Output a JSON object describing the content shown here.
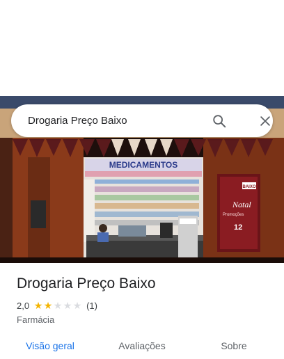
{
  "search": {
    "query": "Drogaria Preço Baixo"
  },
  "place": {
    "name": "Drogaria Preço Baixo",
    "rating": "2,0",
    "rating_fraction": 0.4,
    "review_count": "(1)",
    "category": "Farmácia"
  },
  "photo": {
    "sign_text": "MEDICAMENTOS",
    "poster_title": "Natal",
    "poster_sub": "Promoções",
    "poster_number": "12",
    "poster_brand": "BAIXO"
  },
  "tabs": [
    {
      "label": "Visão geral",
      "active": true
    },
    {
      "label": "Avaliações",
      "active": false
    },
    {
      "label": "Sobre",
      "active": false
    }
  ],
  "colors": {
    "accent": "#1a73e8",
    "star": "#f4b400",
    "facade": "#8a3a1a"
  },
  "icons": {
    "search": "search-icon",
    "close": "close-icon"
  }
}
